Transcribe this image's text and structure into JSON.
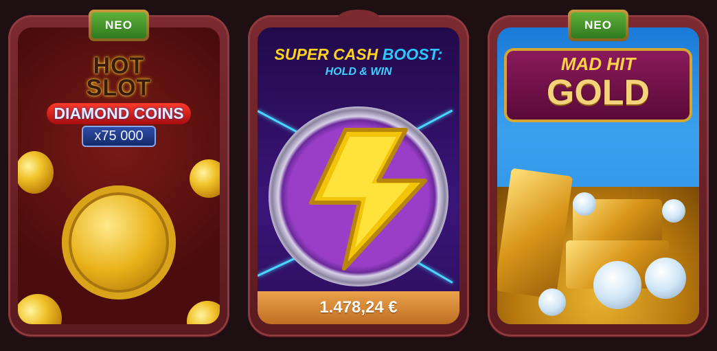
{
  "games": [
    {
      "badge": "NEO",
      "title_line1": "HOT",
      "title_line2": "SLOT",
      "subtitle": "DIAMOND COINS",
      "multiplier": "x75 000"
    },
    {
      "title_part1": "SUPER CASH",
      "title_part2": "BOOST:",
      "subtitle": "HOLD & WIN",
      "jackpot": "1.478,24 €"
    },
    {
      "badge": "NEO",
      "title_line1": "MAD HIT",
      "title_line2": "GOLD"
    }
  ]
}
